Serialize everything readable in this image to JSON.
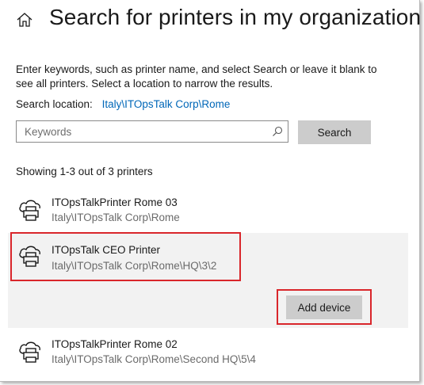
{
  "header": {
    "title": "Search for printers in my organization",
    "home_icon": "home-icon"
  },
  "description": "Enter keywords, such as printer name, and select Search or leave it blank to see all printers. Select a location to narrow the results.",
  "search_location": {
    "label": "Search location:",
    "value": "Italy\\ITOpsTalk Corp\\Rome"
  },
  "search": {
    "placeholder": "Keywords",
    "value": "",
    "button_label": "Search",
    "icon": "search-icon"
  },
  "results": {
    "summary": "Showing 1-3 out of 3 printers",
    "printers": [
      {
        "name": "ITOpsTalkPrinter Rome 03",
        "path": "Italy\\ITOpsTalk Corp\\Rome",
        "icon": "network-printer-icon",
        "selected": false
      },
      {
        "name": "ITOpsTalk CEO Printer",
        "path": "Italy\\ITOpsTalk Corp\\Rome\\HQ\\3\\2",
        "icon": "network-printer-icon",
        "selected": true
      },
      {
        "name": "ITOpsTalkPrinter Rome 02",
        "path": "Italy\\ITOpsTalk Corp\\Rome\\Second HQ\\5\\4",
        "icon": "network-printer-icon",
        "selected": false
      }
    ],
    "add_device_label": "Add device"
  },
  "colors": {
    "link": "#0067b8",
    "highlight": "#d9262b",
    "selected_row": "#f2f2f2",
    "button": "#cccccc"
  }
}
